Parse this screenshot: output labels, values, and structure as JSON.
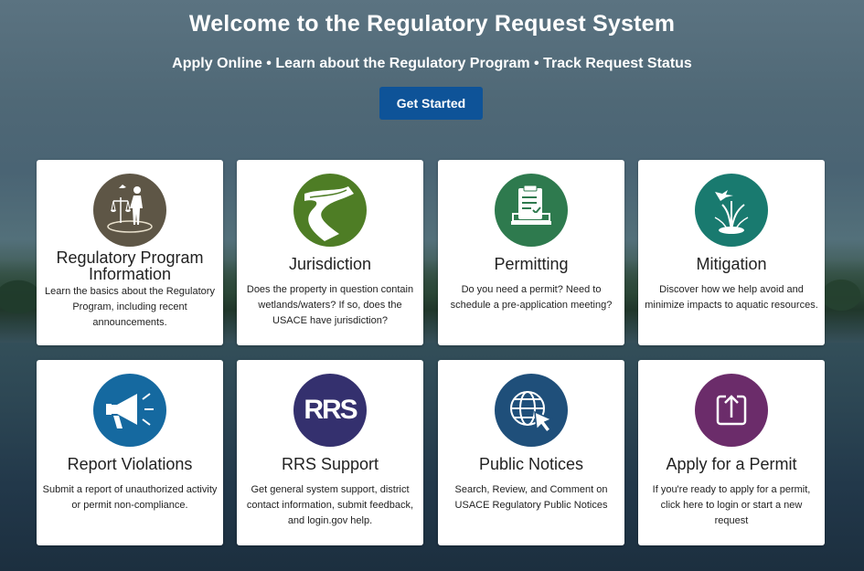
{
  "hero": {
    "title": "Welcome to the Regulatory Request System",
    "subtitle": "Apply Online • Learn about the Regulatory Program • Track Request Status",
    "cta_label": "Get Started"
  },
  "cards": [
    {
      "title": "Regulatory Program Information",
      "desc": "Learn the basics about the Regulatory Program, including recent announcements.",
      "icon": "scales-person-icon",
      "color": "#5e5646"
    },
    {
      "title": "Jurisdiction",
      "desc": "Does the property in question contain wetlands/waters? If so, does the USACE have jurisdiction?",
      "icon": "river-icon",
      "color": "#4e7d25"
    },
    {
      "title": "Permitting",
      "desc": "Do you need a permit? Need to schedule a pre-application meeting?",
      "icon": "checklist-laptop-icon",
      "color": "#2e7a4e"
    },
    {
      "title": "Mitigation",
      "desc": "Discover how we help avoid and minimize impacts to aquatic resources.",
      "icon": "wetland-bird-icon",
      "color": "#197a6f"
    },
    {
      "title": "Report Violations",
      "desc": "Submit a report of unauthorized activity or permit non-compliance.",
      "icon": "megaphone-icon",
      "color": "#1569a0"
    },
    {
      "title": "RRS Support",
      "desc": "Get general system support, district contact information, submit feedback, and login.gov help.",
      "icon": "rrs-logo-icon",
      "color": "#34306e"
    },
    {
      "title": "Public Notices",
      "desc": "Search, Review, and Comment on USACE Regulatory Public Notices",
      "icon": "globe-cursor-icon",
      "color": "#1f4f7a"
    },
    {
      "title": "Apply for a Permit",
      "desc": "If you're ready to apply for a permit, click here to login or start a new request",
      "icon": "upload-icon",
      "color": "#6b2c6a"
    }
  ],
  "rrs_logo_text": "RRS"
}
